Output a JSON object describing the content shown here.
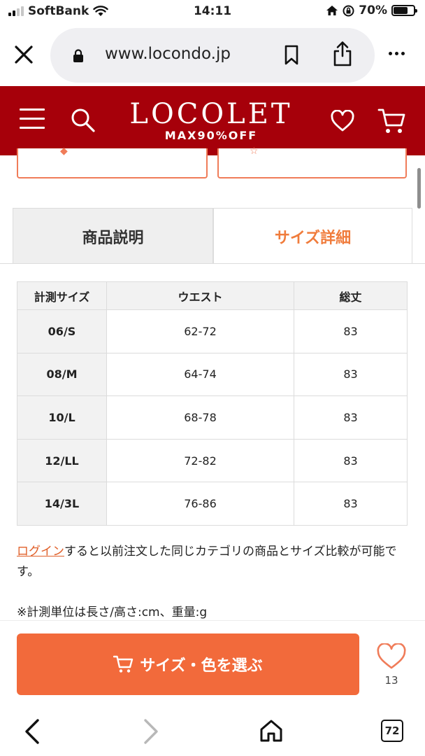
{
  "status_bar": {
    "carrier": "SoftBank",
    "time": "14:11",
    "battery": "70%",
    "battery_level": 0.7
  },
  "browser": {
    "url": "www.locondo.jp",
    "tab_count": "72"
  },
  "header": {
    "logo_main": "LOCOLET",
    "logo_sub": "MAX90%OFF"
  },
  "tabs": {
    "description": "商品説明",
    "size_detail": "サイズ詳細"
  },
  "size_table": {
    "headers": [
      "計測サイズ",
      "ウエスト",
      "総丈"
    ],
    "rows": [
      [
        "06/S",
        "62-72",
        "83"
      ],
      [
        "08/M",
        "64-74",
        "83"
      ],
      [
        "10/L",
        "68-78",
        "83"
      ],
      [
        "12/LL",
        "72-82",
        "83"
      ],
      [
        "14/3L",
        "76-86",
        "83"
      ]
    ]
  },
  "notes": {
    "login_link": "ログイン",
    "login_text": "すると以前注文した同じカテゴリの商品とサイズ比較が可能です。",
    "unit_note": "※計測単位は長さ/高さ:cm、重量:g"
  },
  "action": {
    "select_label": "サイズ・色を選ぶ",
    "favorite_count": "13"
  },
  "colors": {
    "header_bg": "#a6000a",
    "accent": "#f26a3b",
    "active_tab": "#f07c3c"
  }
}
